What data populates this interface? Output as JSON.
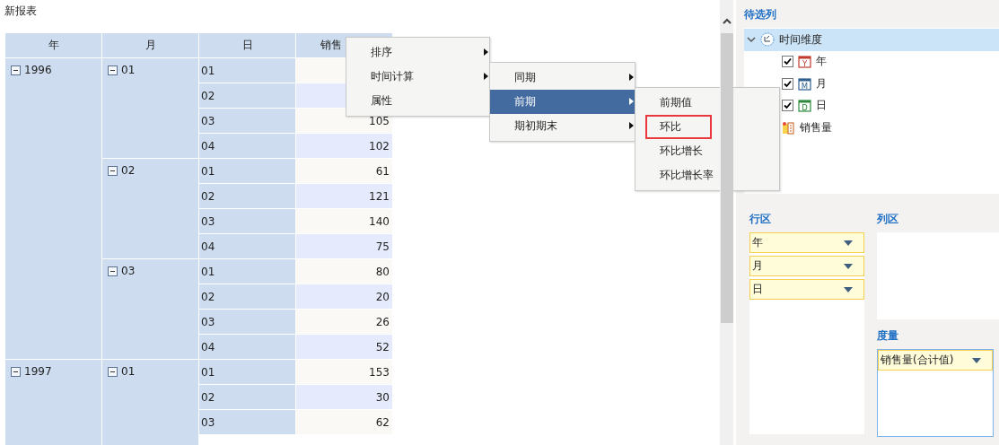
{
  "title": "新报表",
  "table": {
    "columns": [
      "年",
      "月",
      "日",
      "销售"
    ],
    "years": [
      {
        "label": "1996",
        "expanded": true,
        "months": [
          {
            "label": "01",
            "expanded": true,
            "days": [
              {
                "day": "01"
              },
              {
                "day": "02"
              },
              {
                "day": "03",
                "value": "105"
              },
              {
                "day": "04",
                "value": "102"
              }
            ]
          },
          {
            "label": "02",
            "expanded": true,
            "days": [
              {
                "day": "01",
                "value": "61"
              },
              {
                "day": "02",
                "value": "121"
              },
              {
                "day": "03",
                "value": "140"
              },
              {
                "day": "04",
                "value": "75"
              }
            ]
          },
          {
            "label": "03",
            "expanded": true,
            "days": [
              {
                "day": "01",
                "value": "80"
              },
              {
                "day": "02",
                "value": "20"
              },
              {
                "day": "03",
                "value": "26"
              },
              {
                "day": "04",
                "value": "52"
              }
            ]
          }
        ]
      },
      {
        "label": "1997",
        "expanded": true,
        "months": [
          {
            "label": "01",
            "expanded": true,
            "days": [
              {
                "day": "01",
                "value": "153"
              },
              {
                "day": "02",
                "value": "30"
              },
              {
                "day": "03",
                "value": "62"
              }
            ]
          }
        ]
      }
    ]
  },
  "context_menus": [
    {
      "items": [
        {
          "label": "排序",
          "has_submenu": true,
          "selected": false
        },
        {
          "label": "时间计算",
          "has_submenu": true,
          "selected": false
        },
        {
          "label": "属性",
          "has_submenu": false,
          "selected": false
        }
      ]
    },
    {
      "items": [
        {
          "label": "同期",
          "has_submenu": true,
          "selected": false
        },
        {
          "label": "前期",
          "has_submenu": true,
          "selected": true
        },
        {
          "label": "期初期末",
          "has_submenu": true,
          "selected": false
        }
      ]
    },
    {
      "items": [
        {
          "label": "前期值",
          "has_submenu": false,
          "selected": false,
          "marked": false
        },
        {
          "label": "环比",
          "has_submenu": false,
          "selected": false,
          "marked": true
        },
        {
          "label": "环比增长",
          "has_submenu": false,
          "selected": false,
          "marked": false
        },
        {
          "label": "环比增长率",
          "has_submenu": false,
          "selected": false,
          "marked": false
        }
      ]
    }
  ],
  "field_list": {
    "title": "待选列",
    "tree": [
      {
        "label": "时间维度",
        "kind": "group",
        "expanded": true,
        "selected": true,
        "children": [
          {
            "label": "年",
            "kind": "date",
            "icon_text": "Y",
            "color": "#c0392b",
            "checked": true,
            "selected": false
          },
          {
            "label": "月",
            "kind": "date",
            "icon_text": "M",
            "color": "#2e5f8f",
            "checked": true,
            "selected": false
          },
          {
            "label": "日",
            "kind": "date",
            "icon_text": "D",
            "color": "#2e8b3e",
            "checked": true,
            "selected": false
          }
        ]
      },
      {
        "label": "销售量",
        "kind": "measure",
        "selected": false
      }
    ]
  },
  "rows_area": {
    "title": "行区",
    "fields": [
      {
        "label": "年"
      },
      {
        "label": "月"
      },
      {
        "label": "日"
      }
    ]
  },
  "columns_area": {
    "title": "列区"
  },
  "measures_area": {
    "title": "度量",
    "focused": true,
    "fields": [
      {
        "label": "销售量(合计值)"
      }
    ]
  }
}
